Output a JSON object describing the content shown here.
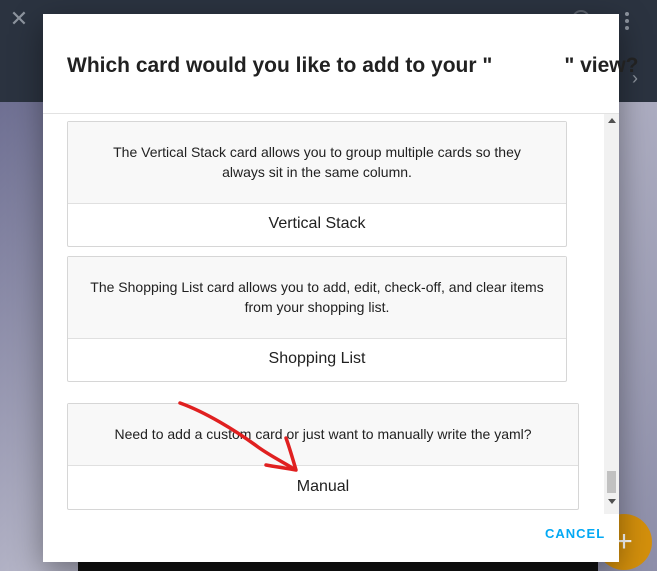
{
  "dialog": {
    "title_before": "Which card would you like to add to your \"",
    "title_after": "\" view?",
    "cancel_label": "CANCEL"
  },
  "cards": [
    {
      "description": "The Vertical Stack card allows you to group multiple cards so they always sit in the same column.",
      "name": "Vertical Stack"
    },
    {
      "description": "The Shopping List card allows you to add, edit, check-off, and clear items from your shopping list.",
      "name": "Shopping List"
    },
    {
      "description": "Need to add a custom card or just want to manually write the yaml?",
      "name": "Manual"
    }
  ],
  "background": {
    "fab_glyph": "+",
    "close_glyph": "✕",
    "chevron_glyph": "›"
  },
  "colors": {
    "accent": "#03a9f4",
    "fab": "#d4900c",
    "annotation": "#e02020"
  },
  "icons": {
    "close": "close-icon",
    "help": "help-icon",
    "more": "more-vert-icon",
    "chevron": "chevron-right-icon",
    "fab": "plus-icon",
    "scroll_up": "arrow-up-icon",
    "scroll_down": "arrow-down-icon"
  }
}
